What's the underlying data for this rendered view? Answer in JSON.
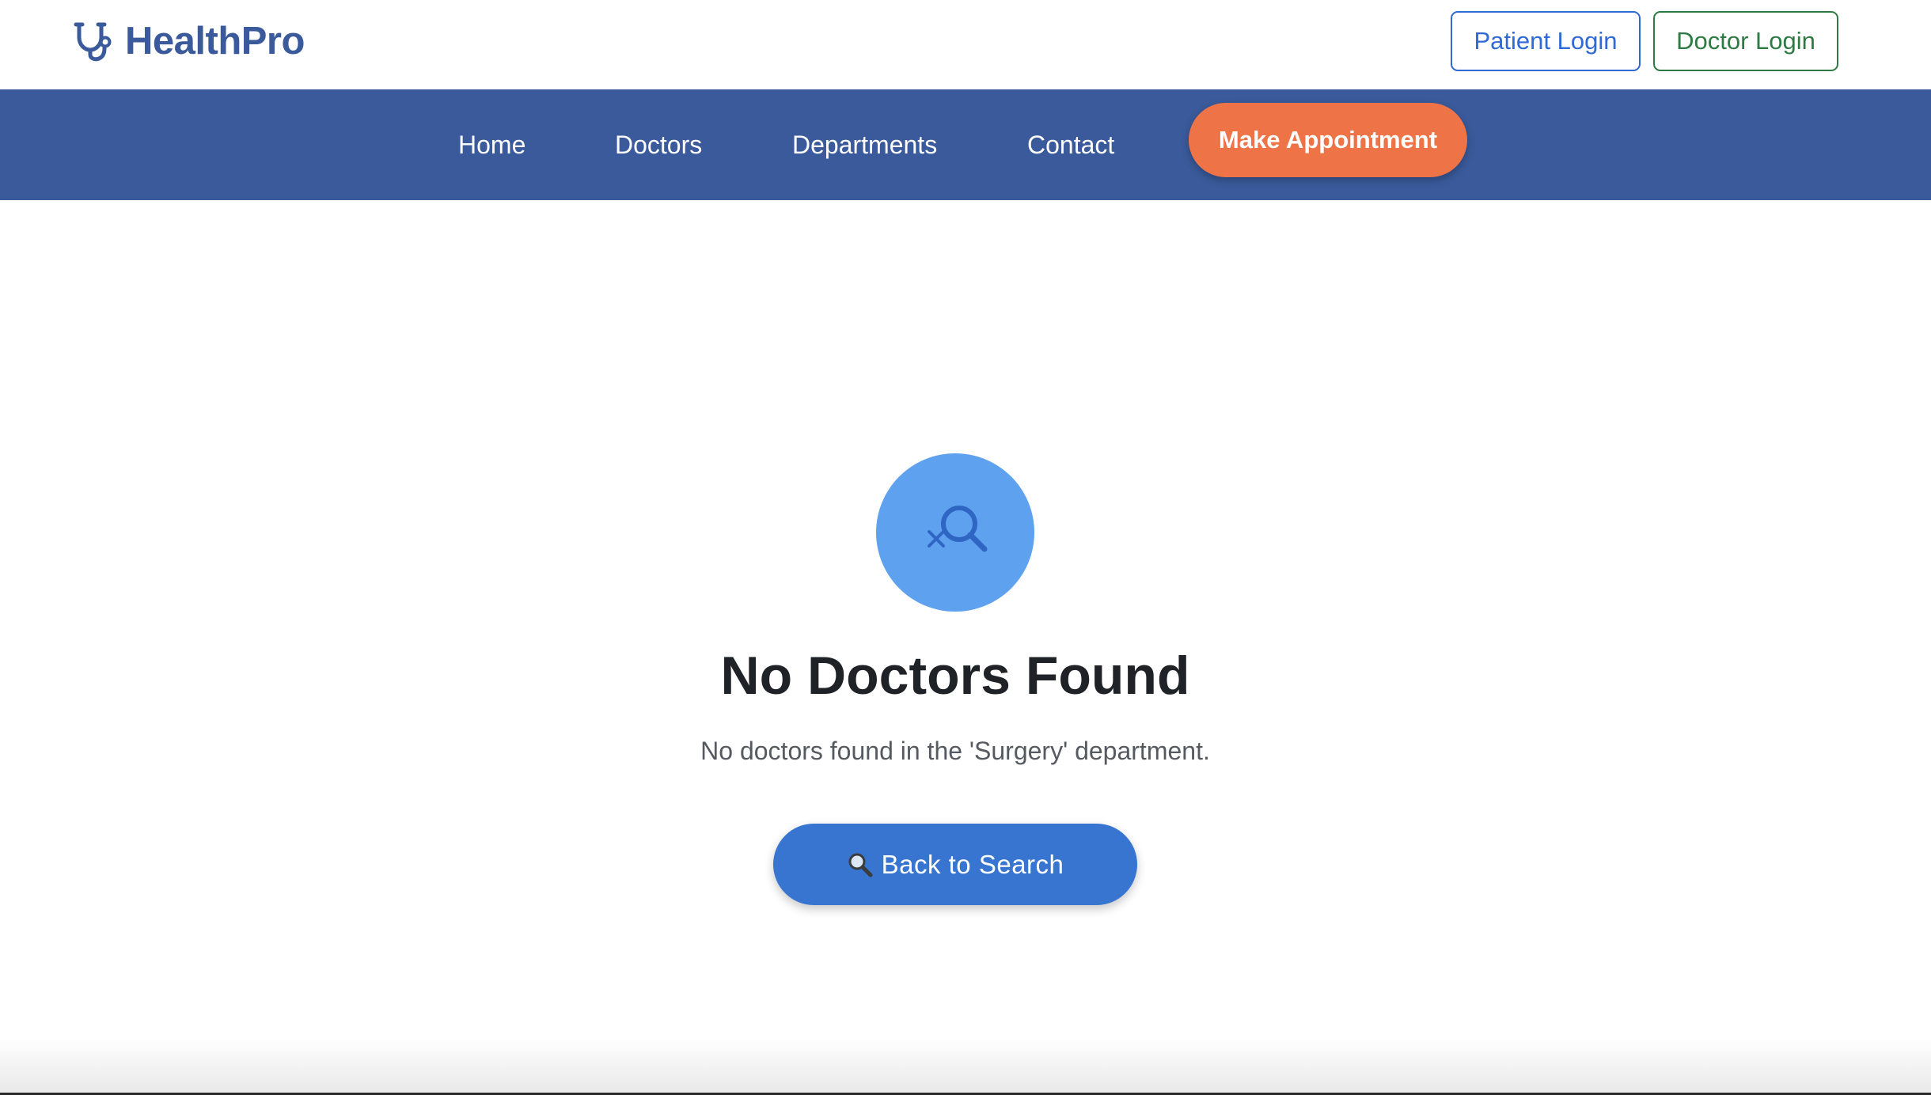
{
  "header": {
    "brand_name": "HealthPro",
    "brand_icon": "stethoscope-icon",
    "patient_login_label": "Patient Login",
    "doctor_login_label": "Doctor Login"
  },
  "nav": {
    "items": [
      {
        "label": "Home"
      },
      {
        "label": "Doctors"
      },
      {
        "label": "Departments"
      },
      {
        "label": "Contact"
      }
    ],
    "cta_label": "Make Appointment"
  },
  "empty_state": {
    "icon": "search-not-found-icon",
    "title": "No Doctors Found",
    "message": "No doctors found in the 'Surgery' department.",
    "button_icon": "magnifying-glass-icon",
    "button_label": "Back to Search"
  },
  "colors": {
    "brand": "#3a5a9b",
    "nav_background": "#3a5a9b",
    "cta": "#ee7447",
    "patient_login": "#2e69d6",
    "doctor_login": "#2f7a44",
    "icon_circle": "#5ea1ef",
    "primary_button": "#3875d1"
  }
}
